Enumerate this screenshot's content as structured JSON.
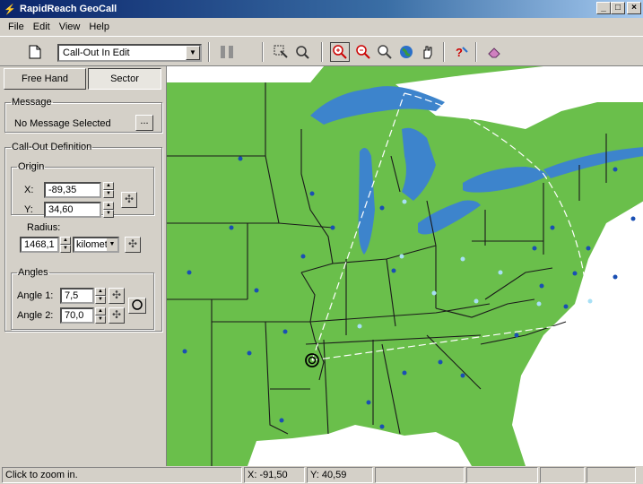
{
  "window": {
    "title": "RapidReach GeoCall"
  },
  "menu": [
    "File",
    "Edit",
    "View",
    "Help"
  ],
  "toolbar": {
    "mode_combo": "Call-Out In Edit",
    "icons": [
      "new-icon",
      "pause-icon",
      "select-icon",
      "query-icon",
      "zoom-in-icon",
      "zoom-out-icon",
      "zoom-extent-icon",
      "globe-icon",
      "pan-icon",
      "help-icon",
      "eraser-icon"
    ]
  },
  "tabs": {
    "freehand": "Free Hand",
    "sector": "Sector"
  },
  "message": {
    "legend": "Message",
    "value": "No Message Selected",
    "button": "..."
  },
  "callout": {
    "legend": "Call-Out Definition",
    "origin_legend": "Origin",
    "x_label": "X:",
    "x_value": "-89,35",
    "y_label": "Y:",
    "y_value": "34,60",
    "radius_label": "Radius:",
    "radius_value": "1468,1",
    "radius_unit": "kilomete",
    "angles_legend": "Angles",
    "angle1_label": "Angle 1:",
    "angle1_value": "7,5",
    "angle2_label": "Angle 2:",
    "angle2_value": "70,0"
  },
  "status": {
    "hint": "Click to zoom in.",
    "x": "X: -91,50",
    "y": "Y: 40,59"
  },
  "colors": {
    "land": "#6abf4b",
    "water": "#3d84cc",
    "title_start": "#0a246a"
  }
}
